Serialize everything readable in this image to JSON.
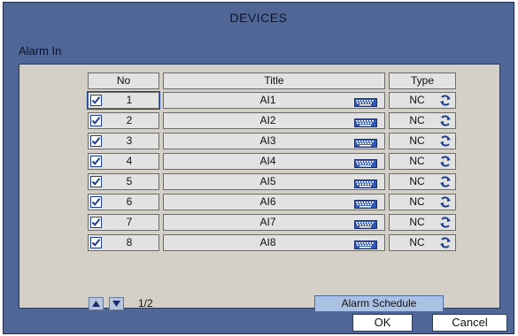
{
  "window": {
    "title": "DEVICES",
    "section": "Alarm In"
  },
  "table": {
    "headers": {
      "no": "No",
      "title": "Title",
      "type": "Type"
    },
    "rows": [
      {
        "no": "1",
        "title": "AI1",
        "type": "NC",
        "checked": true
      },
      {
        "no": "2",
        "title": "AI2",
        "type": "NC",
        "checked": true
      },
      {
        "no": "3",
        "title": "AI3",
        "type": "NC",
        "checked": true
      },
      {
        "no": "4",
        "title": "AI4",
        "type": "NC",
        "checked": true
      },
      {
        "no": "5",
        "title": "AI5",
        "type": "NC",
        "checked": true
      },
      {
        "no": "6",
        "title": "AI6",
        "type": "NC",
        "checked": true
      },
      {
        "no": "7",
        "title": "AI7",
        "type": "NC",
        "checked": true
      },
      {
        "no": "8",
        "title": "AI8",
        "type": "NC",
        "checked": true
      }
    ],
    "icons": {
      "title_button": "keyboard-icon",
      "type_button": "cycle-icon"
    }
  },
  "pagination": {
    "text": "1/2",
    "prev_icon": "arrow-up-icon",
    "next_icon": "arrow-down-icon"
  },
  "buttons": {
    "schedule": "Alarm Schedule",
    "ok": "OK",
    "cancel": "Cancel"
  },
  "colors": {
    "window_bg": "#4f6696",
    "panel_bg": "#d4d0c8",
    "accent": "#1f3f8f",
    "schedule_bg": "#abc1e3"
  }
}
